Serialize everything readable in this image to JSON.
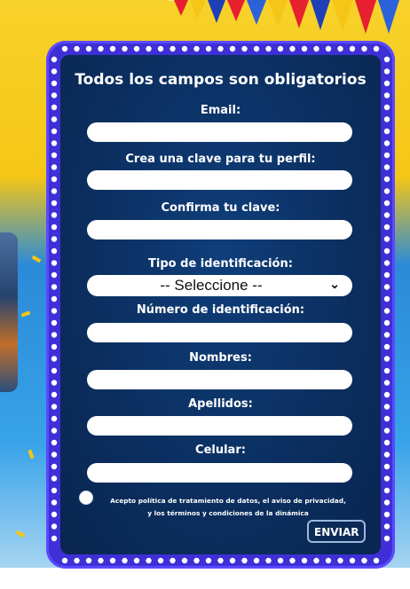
{
  "form": {
    "title": "Todos los campos son obligatorios",
    "fields": {
      "email": {
        "label": "Email:",
        "value": ""
      },
      "password": {
        "label": "Crea una clave para tu perfil:",
        "value": ""
      },
      "confirm_password": {
        "label": "Confirma tu clave:",
        "value": ""
      },
      "id_type": {
        "label": "Tipo de identificación:",
        "selected": "-- Seleccione --"
      },
      "id_number": {
        "label": "Número de identificación:",
        "value": ""
      },
      "first_names": {
        "label": "Nombres:",
        "value": ""
      },
      "last_names": {
        "label": "Apellidos:",
        "value": ""
      },
      "phone": {
        "label": "Celular:",
        "value": ""
      }
    },
    "consent_line1": "Acepto política de tratamiento de datos, el aviso de privacidad,",
    "consent_line2": "y los términos y condiciones de la dinámica",
    "submit_label": "ENVIAR"
  },
  "colors": {
    "panel": "#0b2f60",
    "marquee": "#3e2fd6",
    "bulb": "#ffffff",
    "background_top": "#f5c617",
    "background_bottom": "#37a3e8"
  },
  "icons": {
    "select_chevron": "chevron-down-icon"
  }
}
